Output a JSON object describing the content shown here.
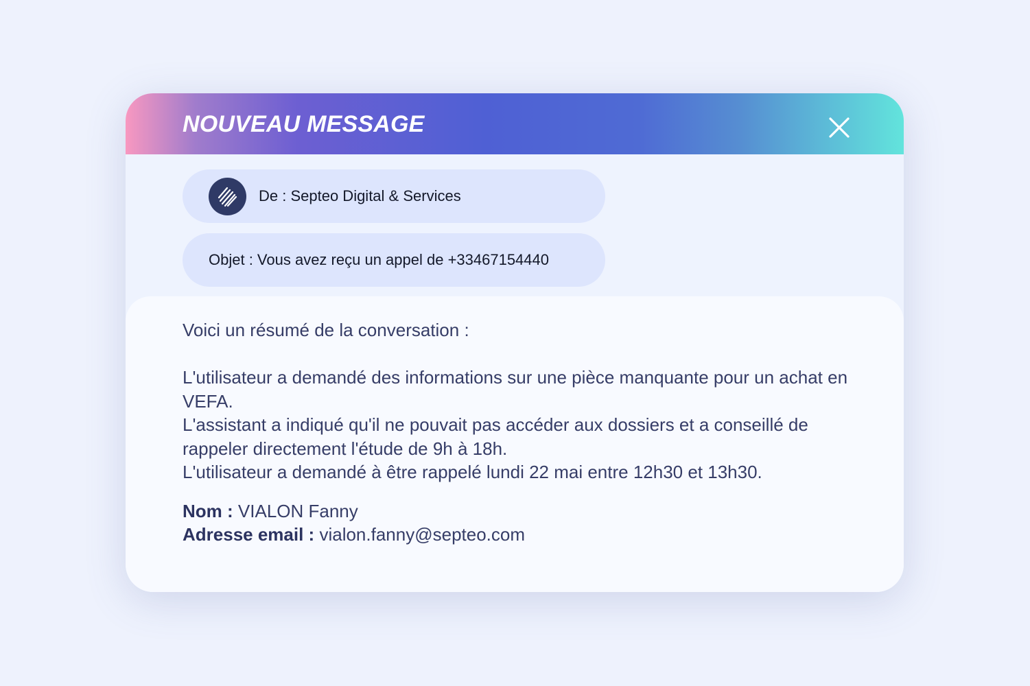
{
  "header": {
    "title": "NOUVEAU MESSAGE",
    "close_icon": "close-icon"
  },
  "from": {
    "avatar_icon": "septeo-logo",
    "text": "De : Septeo Digital & Services"
  },
  "subject": {
    "text": "Objet : Vous avez reçu un appel de +33467154440"
  },
  "body": {
    "intro": "Voici un résumé de la conversation :",
    "line1": "L'utilisateur a demandé des informations sur une pièce manquante pour un achat en VEFA.",
    "line2": "L'assistant a indiqué qu'il ne pouvait pas accéder aux dossiers et a conseillé de rappeler directement l'étude de 9h à 18h.",
    "line3": "L'utilisateur a demandé à être rappelé lundi 22 mai entre 12h30 et 13h30.",
    "name_label": "Nom :",
    "name_value": "VIALON Fanny",
    "email_label": "Adresse email :",
    "email_value": "vialon.fanny@septeo.com"
  },
  "colors": {
    "page_background": "#eef2fd",
    "header_gradient": [
      "#f898c0",
      "#6d5fd2",
      "#4f60d4",
      "#62e4dc"
    ],
    "pill_background": "#dde5fd",
    "avatar_background": "#2f3a66",
    "body_text": "#363d67"
  }
}
